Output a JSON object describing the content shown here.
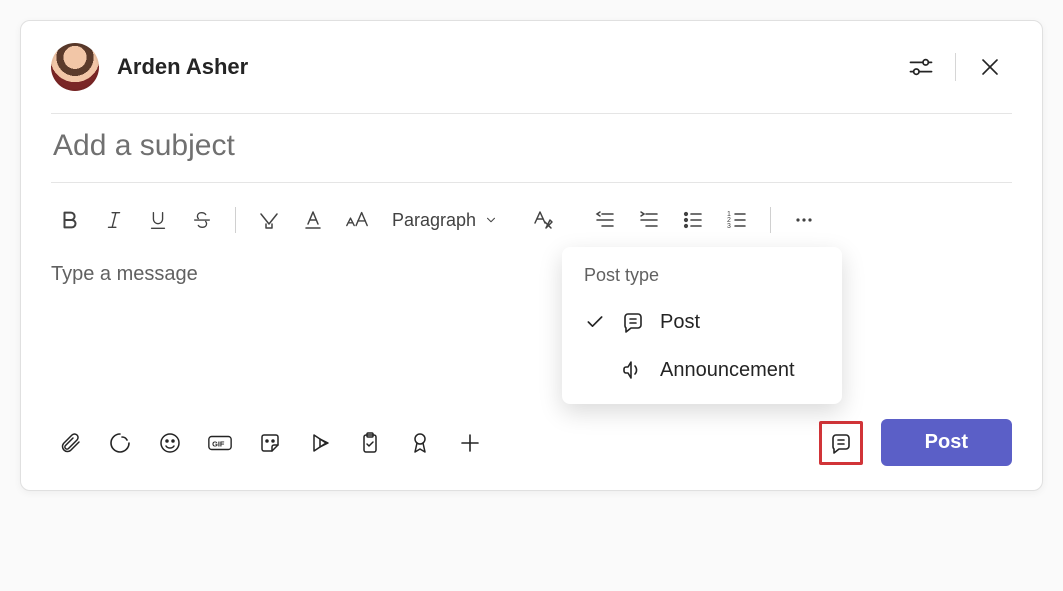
{
  "header": {
    "author_name": "Arden Asher",
    "settings_icon": "filter-settings-icon",
    "close_icon": "close-icon"
  },
  "subject": {
    "placeholder": "Add a subject",
    "value": ""
  },
  "format_toolbar": {
    "style_dropdown_label": "Paragraph"
  },
  "message": {
    "placeholder": "Type a message"
  },
  "popover": {
    "title": "Post type",
    "items": [
      {
        "label": "Post",
        "selected": true,
        "icon": "post-icon"
      },
      {
        "label": "Announcement",
        "selected": false,
        "icon": "megaphone-icon"
      }
    ]
  },
  "actions": {
    "post_label": "Post"
  }
}
